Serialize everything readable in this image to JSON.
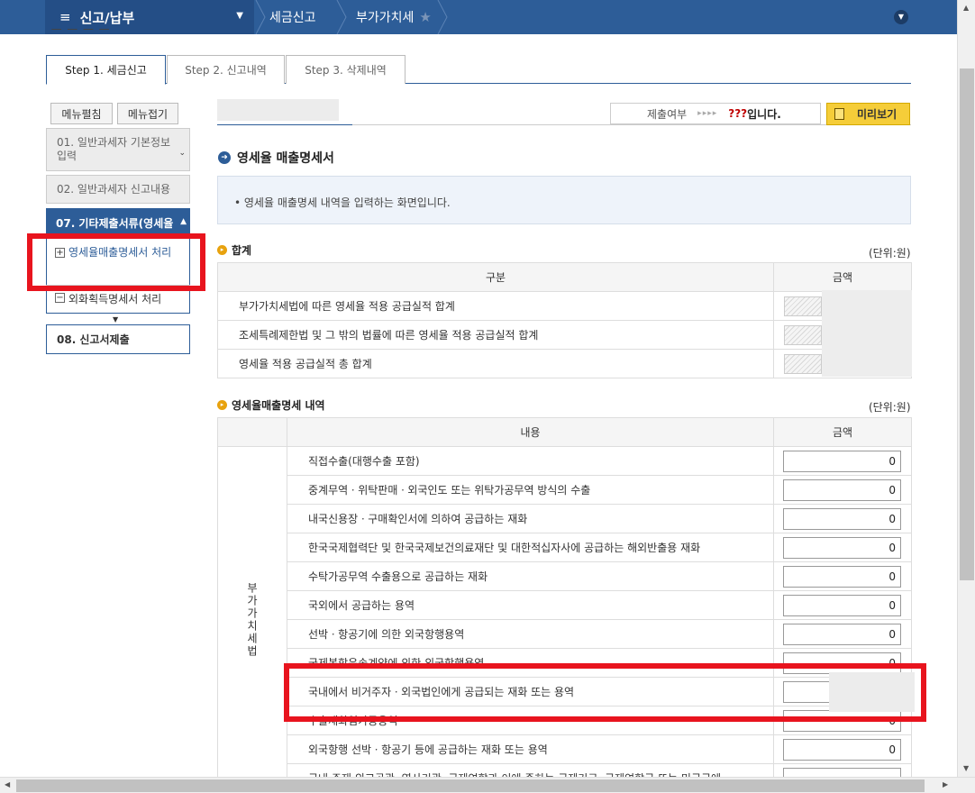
{
  "topbar": {
    "menu_icon": "≡",
    "menu_title": "신고/납부",
    "crumb1": "세금신고",
    "crumb2": "부가가치세",
    "star": "★",
    "expand_icon": "⌄"
  },
  "steps": [
    "Step 1. 세금신고",
    "Step 2. 신고내역",
    "Step 3. 삭제내역"
  ],
  "sidebar": {
    "expand_label": "메뉴펼침",
    "collapse_label": "메뉴접기",
    "item1": "01. 일반과세자 기본정보입력",
    "item2": "02. 일반과세자 신고내용",
    "active": "07. 기타제출서류(영세율",
    "sub1": "영세율매출명세서 처리",
    "sub2": "외화획득명세서 처리",
    "last": "08. 신고서제출",
    "plus": "+",
    "minus": "−"
  },
  "submit": {
    "label": "제출여부",
    "arrows": "▸▸▸▸",
    "status_q": "???",
    "status_tail": "입니다."
  },
  "preview_label": "미리보기",
  "section_title": "영세율 매출명세서",
  "info_text": "• 영세율 매출명세 내역을 입력하는 화면입니다.",
  "total": {
    "title": "합계",
    "unit": "(단위:원)",
    "col_label": "구분",
    "col_amount": "금액",
    "rows": [
      "부가가치세법에 따른 영세율 적용 공급실적 합계",
      "조세특례제한법 및 그 밖의 법률에 따른 영세율 적용 공급실적 합계",
      "영세율 적용 공급실적 총 합계"
    ]
  },
  "detail": {
    "title": "영세율매출명세 내역",
    "unit": "(단위:원)",
    "col_content": "내용",
    "col_amount": "금액",
    "group_label": "부가가치세법",
    "rows": [
      {
        "label": "직접수출(대행수출 포함)",
        "value": "0"
      },
      {
        "label": "중계무역ㆍ위탁판매ㆍ외국인도 또는 위탁가공무역 방식의 수출",
        "value": "0"
      },
      {
        "label": "내국신용장ㆍ구매확인서에 의하여 공급하는 재화",
        "value": "0"
      },
      {
        "label": "한국국제협력단 및 한국국제보건의료재단 및 대한적십자사에 공급하는 해외반출용 재화",
        "value": "0"
      },
      {
        "label": "수탁가공무역 수출용으로 공급하는 재화",
        "value": "0"
      },
      {
        "label": "국외에서 공급하는 용역",
        "value": "0"
      },
      {
        "label": "선박ㆍ항공기에 의한 외국항행용역",
        "value": "0"
      },
      {
        "label": "국제복합운송계약에 의한 외국항행용역",
        "value": "0"
      },
      {
        "label": "국내에서 비거주자ㆍ외국법인에게 공급되는 재화 또는 용역",
        "value": ""
      },
      {
        "label": "수출재화임가공용역",
        "value": "0"
      },
      {
        "label": "외국항행 선박ㆍ항공기 등에 공급하는 재화 또는 용역",
        "value": "0"
      },
      {
        "label": "국내 주재 외교공관, 영사기관, 국제연합과 이에 준하는 국제기구, 국제연합군 또는 미국군에",
        "value": ""
      }
    ]
  }
}
